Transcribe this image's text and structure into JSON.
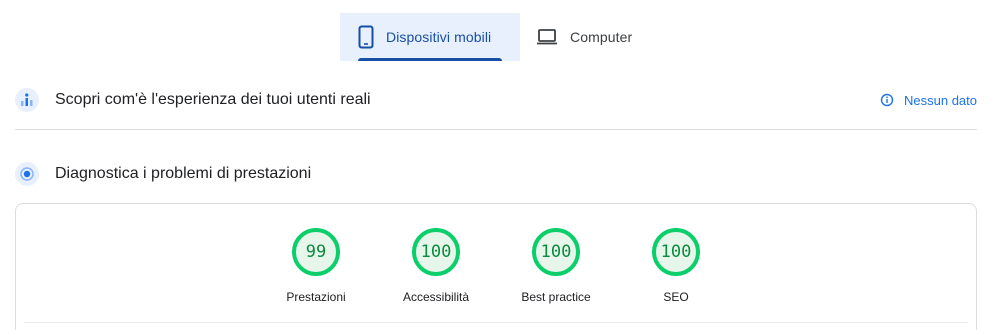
{
  "device_tabs": {
    "mobile": {
      "label": "Dispositivi mobili",
      "icon": "smartphone-icon",
      "selected": true
    },
    "desktop": {
      "label": "Computer",
      "icon": "laptop-icon",
      "selected": false
    }
  },
  "field_data": {
    "title": "Scopri com'è l'esperienza dei tuoi utenti reali",
    "status": "Nessun dato",
    "status_icon": "info-icon"
  },
  "diagnostics": {
    "title": "Diagnostica i problemi di prestazioni"
  },
  "scores": [
    {
      "value": "99",
      "label": "Prestazioni"
    },
    {
      "value": "100",
      "label": "Accessibilità"
    },
    {
      "value": "100",
      "label": "Best practice"
    },
    {
      "value": "100",
      "label": "SEO"
    }
  ],
  "colors": {
    "accent": "#174ea6",
    "link": "#1a73e8",
    "pass": "#0cce6b",
    "pass_text": "#0d8a3e",
    "tab_selected_bg": "#e8f0fe"
  }
}
